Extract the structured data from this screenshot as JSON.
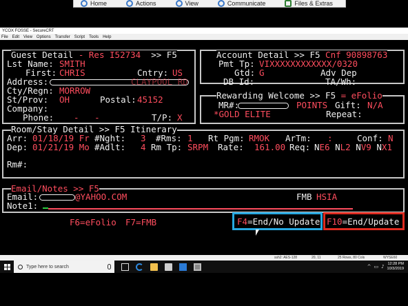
{
  "remote_toolbar": {
    "items": [
      "Home",
      "Actions",
      "View",
      "Communicate",
      "Files & Extras"
    ]
  },
  "window": {
    "title": "YCOX FOSSE - SecureCRT",
    "menu": [
      "File",
      "Edit",
      "View",
      "Options",
      "Transfer",
      "Script",
      "Tools",
      "Help"
    ]
  },
  "guest": {
    "header": "Guest Detail",
    "res_label": "- Res",
    "res_no": "I52734",
    "nav": ">> F5",
    "last_name_label": "Lst Name:",
    "last_name": "SMITH",
    "first_label": "First:",
    "first": "CHRIS",
    "cntry_label": "Cntry:",
    "cntry": "US",
    "address_label": "Address:",
    "address_tail": "CLAYPOOL RD",
    "city_label": "Cty/Regn:",
    "city": "MORROW",
    "state_label": "St/Prov:",
    "state": "OH",
    "postal_label": "Postal:",
    "postal": "45152",
    "company_label": "Company:",
    "phone_label": "Phone:",
    "phone": "-   -",
    "tp_label": "T/P:",
    "tp": "X"
  },
  "account": {
    "header": "Account Detail >> F5",
    "cnf_label": "Cnf",
    "cnf": "90898763",
    "pmt_label": "Pmt Tp:",
    "pmt": "VIXXXXXXXXXXXX/0320",
    "gtd_label": "Gtd:",
    "gtd": "G",
    "adv_dep_label": "Adv Dep",
    "db_id_label": "DB Id:",
    "ta_wh_label": "TA/Wh:"
  },
  "rewards": {
    "header": "Rewarding Welcome >> F5",
    "efolio": "= eFolio",
    "mr_label": "MR#:",
    "points": "POINTS",
    "gift_label": "Gift:",
    "gift": "N/A",
    "tier": "*GOLD ELITE",
    "repeat_label": "Repeat:"
  },
  "stay": {
    "header": "Room/Stay Detail >> F5 Itinerary",
    "arr_label": "Arr:",
    "arr": "01/18/19 Fr",
    "nght_label": "#Nght:",
    "nght": "3",
    "rms_label": "#Rms:",
    "rms": "1",
    "rt_pgm_label": "Rt Pgm:",
    "rt_pgm": "RMOK",
    "artm_label": "ArTm:",
    "artm": ":",
    "conf_label": "Conf:",
    "conf": "N",
    "dep_label": "Dep:",
    "dep": "01/21/19 Mo",
    "adlt_label": "#Adlt:",
    "adlt": "4",
    "rm_tp_label": "Rm Tp:",
    "rm_tp": "SRPM",
    "rate_label": "Rate:",
    "rate": "161.00",
    "req_label": "Req:",
    "req_codes": [
      "N",
      "E6",
      "N",
      "L2",
      "N",
      "V9",
      "N",
      "X1"
    ],
    "rm_label": "Rm#:"
  },
  "email": {
    "header": "Email/Notes >> F5",
    "email_label": "Email:",
    "email_domain": "@YAHOO.COM",
    "fmb_label": "FMB",
    "fmb": "HSIA",
    "notes_label": "Note1:"
  },
  "fkeys": {
    "f6": "F6=eFolio",
    "f7": "F7=FMB",
    "f4_key": "F4",
    "f4_text": "=End/No Update",
    "f10_key": "F10",
    "f10_text": "=End/Update"
  },
  "status_bar": {
    "ssh": "ssh2: AES-128",
    "pos": "20, 11",
    "size": "25 Rows, 80 Cols",
    "term": "WYSE60"
  },
  "taskbar": {
    "search_placeholder": "Type here to search",
    "time": "12:28 PM",
    "date": "10/3/2019"
  }
}
